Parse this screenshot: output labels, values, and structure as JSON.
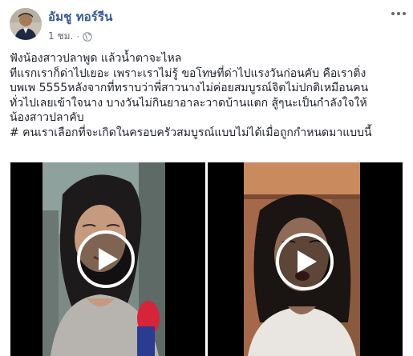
{
  "post": {
    "author": "อัมชู ทอร์รีน",
    "time": "1 ชม.",
    "separator": "·",
    "text_lines": [
      "ฟังน้องสาวปลาพูด แล้วน้ำตาจะไหล",
      "ทีแรกเราก็ด่าไปเยอะ เพราะเราไม่รู้ ขอโทษที่ด่าไปแรงวันก่อนคับ คือเราติ่ง",
      "บพเพ 5555หลังจากที่ทราบว่าพี่สาวนางไม่ค่อยสมบูรณ์จิตไม่ปกติเหมือนคน",
      "ทั่วไปเลยเข้าใจนาง บางวันไม่กินยาอาละวาดบ้านแตก สู้ๆนะเป็นกำลังใจให้",
      "น้องสาวปลาคับ",
      "# คนเราเลือกที่จะเกิดในครอบครัวสมบูรณ์แบบไม่ได้เมื่อถูกกำหนดมาแบบนี้"
    ]
  },
  "icons": {
    "privacy": "globe-icon",
    "menu": "more-options-icon",
    "play": "play-icon"
  },
  "colors": {
    "author_link": "#385898",
    "meta_text": "#616770",
    "body_text": "#1d2129",
    "video_bg": "#000000",
    "play_ring": "#ffffff"
  },
  "videos": [
    {
      "name": "left",
      "description_hidden": true
    },
    {
      "name": "right",
      "description_hidden": true
    }
  ]
}
